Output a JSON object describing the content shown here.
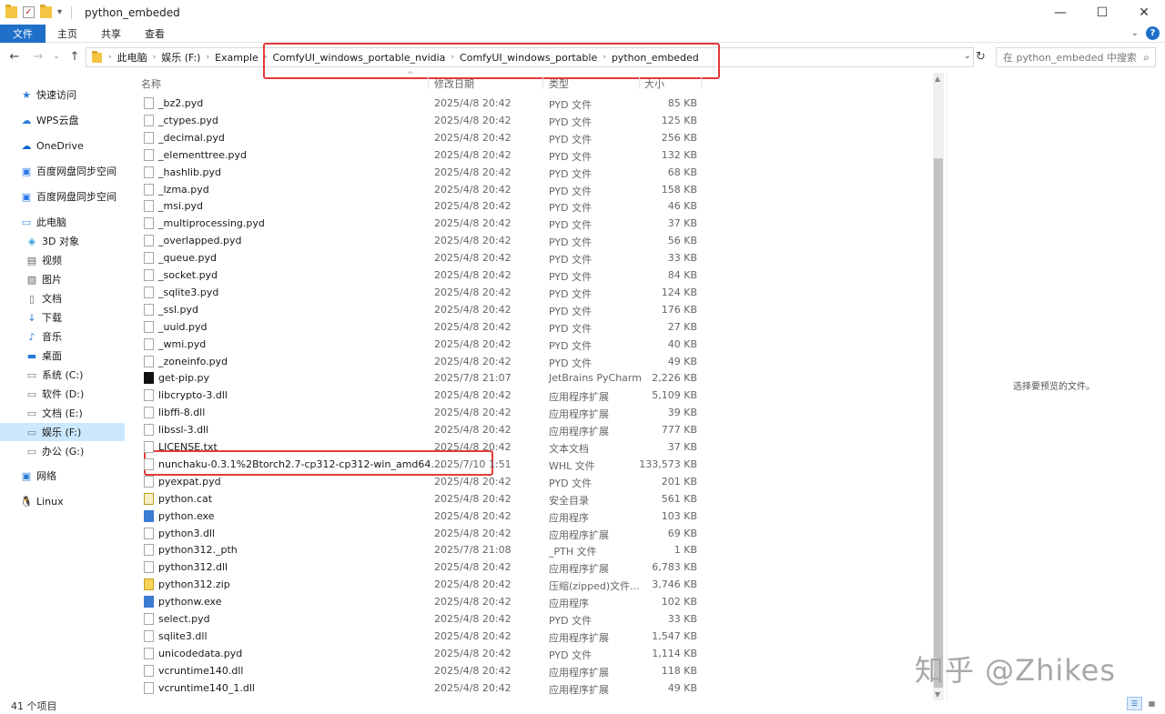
{
  "window": {
    "title": "python_embeded",
    "minimize": "—",
    "maximize": "☐",
    "close": "✕"
  },
  "ribbon": {
    "tabs": [
      "文件",
      "主页",
      "共享",
      "查看"
    ],
    "collapse": "⌄",
    "help": "?"
  },
  "nav": {
    "back": "←",
    "forward": "→",
    "recent": "⌄",
    "up": "↑",
    "refresh": "↻",
    "addr_dropdown": "⌄"
  },
  "breadcrumb": [
    "此电脑",
    "娱乐 (F:)",
    "Example",
    "ComfyUI_windows_portable_nvidia",
    "ComfyUI_windows_portable",
    "python_embeded"
  ],
  "search": {
    "placeholder": "在 python_embeded 中搜索",
    "icon": "⌕"
  },
  "sidebar": {
    "items": [
      {
        "label": "快速访问",
        "icon": "★"
      },
      {
        "label": "WPS云盘",
        "icon": "☁"
      },
      {
        "label": "OneDrive",
        "icon": "☁"
      },
      {
        "label": "百度网盘同步空间",
        "icon": "▣"
      },
      {
        "label": "百度网盘同步空间",
        "icon": "▣"
      },
      {
        "label": "此电脑",
        "icon": "▭"
      },
      {
        "label": "3D 对象",
        "icon": "◈"
      },
      {
        "label": "视频",
        "icon": "▤"
      },
      {
        "label": "图片",
        "icon": "▨"
      },
      {
        "label": "文档",
        "icon": "▯"
      },
      {
        "label": "下载",
        "icon": "↓"
      },
      {
        "label": "音乐",
        "icon": "♪"
      },
      {
        "label": "桌面",
        "icon": "▬"
      },
      {
        "label": "系统 (C:)",
        "icon": "▭"
      },
      {
        "label": "软件 (D:)",
        "icon": "▭"
      },
      {
        "label": "文档 (E:)",
        "icon": "▭"
      },
      {
        "label": "娱乐 (F:)",
        "icon": "▭"
      },
      {
        "label": "办公 (G:)",
        "icon": "▭"
      },
      {
        "label": "网络",
        "icon": "▣"
      },
      {
        "label": "Linux",
        "icon": "🐧"
      }
    ]
  },
  "columns": [
    "名称",
    "修改日期",
    "类型",
    "大小"
  ],
  "column_sort_indicator": "^",
  "files": [
    {
      "name": "_bz2.pyd",
      "date": "2025/4/8 20:42",
      "type": "PYD 文件",
      "size": "85 KB",
      "icon": "pyd"
    },
    {
      "name": "_ctypes.pyd",
      "date": "2025/4/8 20:42",
      "type": "PYD 文件",
      "size": "125 KB",
      "icon": "pyd"
    },
    {
      "name": "_decimal.pyd",
      "date": "2025/4/8 20:42",
      "type": "PYD 文件",
      "size": "256 KB",
      "icon": "pyd"
    },
    {
      "name": "_elementtree.pyd",
      "date": "2025/4/8 20:42",
      "type": "PYD 文件",
      "size": "132 KB",
      "icon": "pyd"
    },
    {
      "name": "_hashlib.pyd",
      "date": "2025/4/8 20:42",
      "type": "PYD 文件",
      "size": "68 KB",
      "icon": "pyd"
    },
    {
      "name": "_lzma.pyd",
      "date": "2025/4/8 20:42",
      "type": "PYD 文件",
      "size": "158 KB",
      "icon": "pyd"
    },
    {
      "name": "_msi.pyd",
      "date": "2025/4/8 20:42",
      "type": "PYD 文件",
      "size": "46 KB",
      "icon": "pyd"
    },
    {
      "name": "_multiprocessing.pyd",
      "date": "2025/4/8 20:42",
      "type": "PYD 文件",
      "size": "37 KB",
      "icon": "pyd"
    },
    {
      "name": "_overlapped.pyd",
      "date": "2025/4/8 20:42",
      "type": "PYD 文件",
      "size": "56 KB",
      "icon": "pyd"
    },
    {
      "name": "_queue.pyd",
      "date": "2025/4/8 20:42",
      "type": "PYD 文件",
      "size": "33 KB",
      "icon": "pyd"
    },
    {
      "name": "_socket.pyd",
      "date": "2025/4/8 20:42",
      "type": "PYD 文件",
      "size": "84 KB",
      "icon": "pyd"
    },
    {
      "name": "_sqlite3.pyd",
      "date": "2025/4/8 20:42",
      "type": "PYD 文件",
      "size": "124 KB",
      "icon": "pyd"
    },
    {
      "name": "_ssl.pyd",
      "date": "2025/4/8 20:42",
      "type": "PYD 文件",
      "size": "176 KB",
      "icon": "pyd"
    },
    {
      "name": "_uuid.pyd",
      "date": "2025/4/8 20:42",
      "type": "PYD 文件",
      "size": "27 KB",
      "icon": "pyd"
    },
    {
      "name": "_wmi.pyd",
      "date": "2025/4/8 20:42",
      "type": "PYD 文件",
      "size": "40 KB",
      "icon": "pyd"
    },
    {
      "name": "_zoneinfo.pyd",
      "date": "2025/4/8 20:42",
      "type": "PYD 文件",
      "size": "49 KB",
      "icon": "pyd"
    },
    {
      "name": "get-pip.py",
      "date": "2025/7/8 21:07",
      "type": "JetBrains PyCharm",
      "size": "2,226 KB",
      "icon": "jb"
    },
    {
      "name": "libcrypto-3.dll",
      "date": "2025/4/8 20:42",
      "type": "应用程序扩展",
      "size": "5,109 KB",
      "icon": "pyd"
    },
    {
      "name": "libffi-8.dll",
      "date": "2025/4/8 20:42",
      "type": "应用程序扩展",
      "size": "39 KB",
      "icon": "pyd"
    },
    {
      "name": "libssl-3.dll",
      "date": "2025/4/8 20:42",
      "type": "应用程序扩展",
      "size": "777 KB",
      "icon": "pyd"
    },
    {
      "name": "LICENSE.txt",
      "date": "2025/4/8 20:42",
      "type": "文本文档",
      "size": "37 KB",
      "icon": "pyd"
    },
    {
      "name": "nunchaku-0.3.1%2Btorch2.7-cp312-cp312-win_amd64....",
      "date": "2025/7/10 1:51",
      "type": "WHL 文件",
      "size": "133,573 KB",
      "icon": "pyd"
    },
    {
      "name": "pyexpat.pyd",
      "date": "2025/4/8 20:42",
      "type": "PYD 文件",
      "size": "201 KB",
      "icon": "pyd"
    },
    {
      "name": "python.cat",
      "date": "2025/4/8 20:42",
      "type": "安全目录",
      "size": "561 KB",
      "icon": "cat"
    },
    {
      "name": "python.exe",
      "date": "2025/4/8 20:42",
      "type": "应用程序",
      "size": "103 KB",
      "icon": "app"
    },
    {
      "name": "python3.dll",
      "date": "2025/4/8 20:42",
      "type": "应用程序扩展",
      "size": "69 KB",
      "icon": "pyd"
    },
    {
      "name": "python312._pth",
      "date": "2025/7/8 21:08",
      "type": "_PTH 文件",
      "size": "1 KB",
      "icon": "pyd"
    },
    {
      "name": "python312.dll",
      "date": "2025/4/8 20:42",
      "type": "应用程序扩展",
      "size": "6,783 KB",
      "icon": "pyd"
    },
    {
      "name": "python312.zip",
      "date": "2025/4/8 20:42",
      "type": "压缩(zipped)文件...",
      "size": "3,746 KB",
      "icon": "zip"
    },
    {
      "name": "pythonw.exe",
      "date": "2025/4/8 20:42",
      "type": "应用程序",
      "size": "102 KB",
      "icon": "pyw"
    },
    {
      "name": "select.pyd",
      "date": "2025/4/8 20:42",
      "type": "PYD 文件",
      "size": "33 KB",
      "icon": "pyd"
    },
    {
      "name": "sqlite3.dll",
      "date": "2025/4/8 20:42",
      "type": "应用程序扩展",
      "size": "1,547 KB",
      "icon": "pyd"
    },
    {
      "name": "unicodedata.pyd",
      "date": "2025/4/8 20:42",
      "type": "PYD 文件",
      "size": "1,114 KB",
      "icon": "pyd"
    },
    {
      "name": "vcruntime140.dll",
      "date": "2025/4/8 20:42",
      "type": "应用程序扩展",
      "size": "118 KB",
      "icon": "pyd"
    },
    {
      "name": "vcruntime140_1.dll",
      "date": "2025/4/8 20:42",
      "type": "应用程序扩展",
      "size": "49 KB",
      "icon": "pyd"
    }
  ],
  "preview": {
    "message": "选择要预览的文件。"
  },
  "status": {
    "count": "41 个项目"
  },
  "watermark": "知乎 @Zhikes",
  "colors": {
    "accent": "#1f6fc8",
    "highlight_box": "#e33a3a",
    "selected_bg": "#cce8ff"
  }
}
